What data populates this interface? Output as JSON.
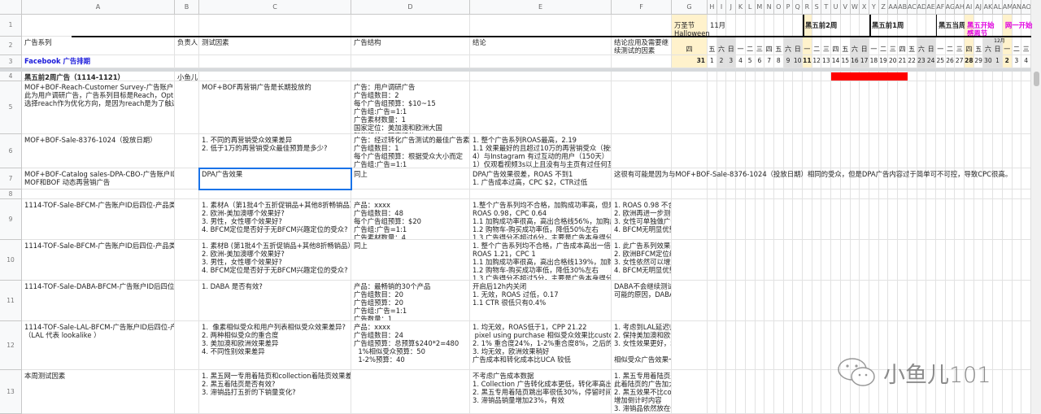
{
  "sheet": {
    "column_letters": [
      "A",
      "B",
      "C",
      "D",
      "E",
      "F",
      "G",
      "H",
      "I",
      "J",
      "K",
      "L",
      "M",
      "N",
      "O",
      "P",
      "Q",
      "R",
      "S",
      "T",
      "U",
      "V",
      "W",
      "X",
      "Y",
      "Z",
      "AA",
      "AB",
      "AC",
      "AD",
      "AE",
      "AF",
      "AG",
      "AH",
      "AI",
      "AJ",
      "AK",
      "AL",
      "AM",
      "AN",
      "AO"
    ],
    "timeline": {
      "days": [
        "31",
        "1",
        "2",
        "3",
        "4",
        "5",
        "6",
        "7",
        "8",
        "9",
        "10",
        "11",
        "12",
        "13",
        "14",
        "15",
        "16",
        "17",
        "18",
        "19",
        "20",
        "21",
        "22",
        "23",
        "24",
        "25",
        "26",
        "27",
        "28",
        "29",
        "30",
        "1",
        "2",
        "3",
        "4"
      ],
      "weekdays": [
        "四",
        "五",
        "六",
        "日",
        "一",
        "二",
        "三",
        "四",
        "五",
        "六",
        "日",
        "一",
        "二",
        "三",
        "四",
        "五",
        "六",
        "日",
        "一",
        "二",
        "三",
        "四",
        "五",
        "六",
        "日",
        "一",
        "二",
        "三",
        "四",
        "五",
        "六",
        "日",
        "一",
        "二",
        "三"
      ],
      "december_label": "12月",
      "highlight_bar": {
        "row": "4",
        "from_day": 14,
        "to_day": 21,
        "month": "11月",
        "color": "#ff0000"
      },
      "highlight_color": "#fff2cc",
      "weekend_color": "#e0e0e0"
    },
    "rows": [
      {
        "num": "1",
        "cells": {
          "G": "万圣节\nHalloween",
          "H": "11月",
          "R": "黑五前2周",
          "Y": "黑五前1周",
          "AF": "黑五当周",
          "AI": "黑五开始\n感恩节",
          "AM": "网一开始"
        }
      },
      {
        "num": "2",
        "cells": {
          "A": "广告系列",
          "B": "负责人",
          "C": "测试因素",
          "D": "广告结构",
          "E": "结论",
          "F": "结论应用及需要继\n续测试的因素"
        }
      },
      {
        "num": "3",
        "cells": {
          "A": "Facebook 广告排期"
        }
      },
      {
        "num": "4",
        "cells": {
          "A": "黑五前2周广告（1114-1121）",
          "B": "小鱼儿"
        }
      },
      {
        "num": "5",
        "cells": {
          "A": "MOF+BOF-Reach-Customer Survey-广告账户ID后四位\n此为用户调研广告，广告系列目标是Reach，Optimization\n选择reach作为优化方向，是因为reach是为了触达所有用户",
          "C": "MOF+BOF再营销广告是长期投放的",
          "D": "广告：用户调研广告\n广告组数目：2\n每个广告组预算：$10~15\n广告组:广告=1:1\n广告素材数量：1\n国家定位：美加澳和欧洲大国\n智能版位：固定版位"
        }
      },
      {
        "num": "6",
        "cells": {
          "A": "MOF+BOF-Sale-8376-1024（投放日期）",
          "C": "1. 不同的再营销受众效果差异\n2. 低于1万的再营销受众最佳预算是多少?",
          "D": "广告：经过转化广告测试的最佳广告素材\n广告组数目：1\n每个广告组预算：根据受众大小而定\n广告组:广告=1:1",
          "E": "1. 整个广告系列ROAS最高，2.19\n1.1 效果最好的且超过10万的再营销受众（按效果好坏排序）\n4）与Instagram 有过互动的用户（150天）\n1）仅观看视频3s以上且没有与主页有过任何互动的用户"
        }
      },
      {
        "num": "7",
        "cells": {
          "A": "MOF+BOF-Catalog sales-DPA-CBO-广告账户ID后四位\nMOF和BOF 动态再营销广告",
          "C": "DPA广告效果",
          "D": "同上",
          "E": "DPA广告效果很差，ROAS 不到1\n1. 广告成本过高，CPC $2，CTR过低",
          "F": "这很有可能是因为与MOF+BOF-Sale-8376-1024（投放日期）相同的受众，但是DPA广告内容过于简单可不可控，导致CPC很高。"
        }
      },
      {
        "num": "8",
        "cells": {}
      },
      {
        "num": "9",
        "cells": {
          "A": "1114-TOF-Sale-BFCM-广告账户ID后四位-产品类别-广告系列",
          "C": "1. 素材A（第1批4个五折促销品+其他8折畅销品）\n2. 欧洲-美加澳哪个效果好?\n3. 男性，女性哪个效果好?\n4. BFCM定位是否好于无BFCM兴趣定位的受众?",
          "D": "产品：xxxx\n广告组数目：48\n每个广告组预算：$20\n广告组:广告=1:1\n广告素材数量：4",
          "E": "1.整个广告系列均不合格，加购成功率高，但是\nROAS 0.98，CPC 0.64\n1.1 加购成功率很高，高出合格线56%，加购成功\n1.2 购物车-购买成功率低，降低50%左右\n1.3 广告得分不超过6分，主要是广告本身得分",
          "F": "1. ROAS 0.98 不合格，但是根据延迟归因乘数，尽可能维持预算不下降\n2. 欧洲再进一步测试\n3. 女性可单独做广告组，增加投放量\n4. BFCM无明显优势，可继续使用"
        }
      },
      {
        "num": "10",
        "cells": {
          "A": "1114-TOF-Sale-BFCM-广告账户ID后四位-产品类别-广告系列",
          "C": "1. 素材B (第1批4个五折促销品+其他8折畅销品）是\n2. 欧洲-美加澳哪个效果好?\n3. 男性，女性哪个效果好?\n4. BFCM定位是否好于无BFCM兴趣定位的受众?",
          "D": "同上",
          "E": "1. 整个广告系列均不合格，广告成本高出一倍。\nROAS 1.21，CPC 1\n1.1 加购成功率很高，高出合格线139%，加购成功\n1.2 购物车-购买成功率低，降低30%左右\n1.3 广告得分不超过5分，主要是广告本身得分",
          "F": "1. 此广告系列效果较好，根据延迟归因乘数可以继续增加预算\n2. 欧洲BFCM定位维持，不再作为特殊因素测试\n3. 女性依然可以增加预算，与男性分开投放\n4. BFCM无明显优势，不再作为特殊因素测试"
        }
      },
      {
        "num": "11",
        "cells": {
          "A": "1114-TOF-Sale-DABA-BFCM-广告账户ID后四位-产品类别",
          "C": "1. DABA 是否有效?",
          "D": "产品：最畅销的30个产品\n广告组数目：20\n广告组预算：20\n广告组:广告=1:1\n广告数量：1",
          "E": "开启后12h内关闭\n1. 无效，ROAS 过低，0.17\n1.1 CTR 很低只有0.4%",
          "F": "DABA不会继续测试，停止投放\n可能的原因，DABA广告展现的图片过于单一"
        }
      },
      {
        "num": "12",
        "cells": {
          "A": "1114-TOF-Sale-LAL-BFCM-广告账户ID后四位-产品类别-广告系列\n（LAL 代表 lookalike ）",
          "C": "1.  像素相似受众和用户列表相似受众效果差异?\n2. 两种相似受众的重合度\n3. 美加澳和欧洲效果差异\n4. 不同性别效果差异",
          "D": "产品：xxxx\n广告组数目：24\n广告组预算：总预算$240*2=480\n  1%相似受众预算：50\n  1-2%预算：40",
          "E": "1. 均无效，ROAS低于1，CPP 21.22\n pixel using purchase 相似受众效果比customer\n2. 1% 重合度24%，1-2%重合度8%，之后的重合度\n3. 均无效，欧洲效果稍好\n广告成本和转化成本比UCA 较低",
          "F": "1. 考虑到LAL延迟归因乘数比较特殊，只有1.18 LAL在黑五网一投放量不做增加\n2. 保持美加澳和欧洲的比例不变\n3. 女性效果更好，增加LAL女性投放量\n\n相似受众广告效果一般可能原因"
        }
      },
      {
        "num": "13",
        "cells": {
          "A": "本周测试因素",
          "C": "1. 黑五网一专用着陆页和collection着陆页效果差异\n2. 黑五着陆页是否有效?\n3. 滞销品打五折的下销量变化?",
          "E": "不考虑广告成本数据\n1. Collection 广告转化成本更低，转化率高出3\n2. 黑五专用着陆页跳出率很低30%，停留时间长\n3. 滞销品销量增加23%，有效",
          "F": "1. 黑五专用着陆页是着陆页首选\n此着陆页的广告加大投放\n2. 黑五效果不比collection差\n增加倒计时内容\n3. 滞销品依然放在促销品下方，有利于去库存"
        }
      }
    ],
    "selected_cell": "C7",
    "watermark": "小鱼儿101"
  }
}
